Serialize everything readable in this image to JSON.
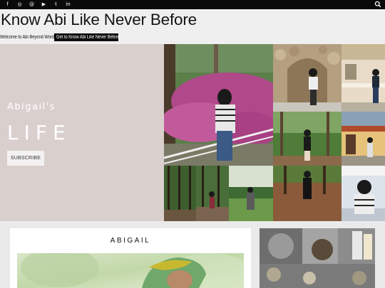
{
  "topbar": {
    "social_icons": [
      "facebook-icon",
      "instagram-icon",
      "threads-icon",
      "youtube-icon",
      "twitter-icon",
      "linkedin-icon"
    ],
    "social_glyphs": [
      "f",
      "◎",
      "@",
      "▶",
      "t",
      "in"
    ],
    "search_icon": "search-icon"
  },
  "header": {
    "site_title": "Know Abi Like Never Before",
    "welcome_text": "Welcome to Abi Beyond Words:",
    "welcome_link": "Get to Know Abi Like Never Before"
  },
  "hero": {
    "name": "Abigail's",
    "headline": "LIFE",
    "subscribe_label": "SUBSCRIBE",
    "background_color": "#d9cfcd"
  },
  "featured": {
    "title": "ABIGAIL"
  },
  "colors": {
    "topbar": "#0a0a0a",
    "page_bg": "#efefef",
    "accent_dark": "#0c0c0c"
  }
}
